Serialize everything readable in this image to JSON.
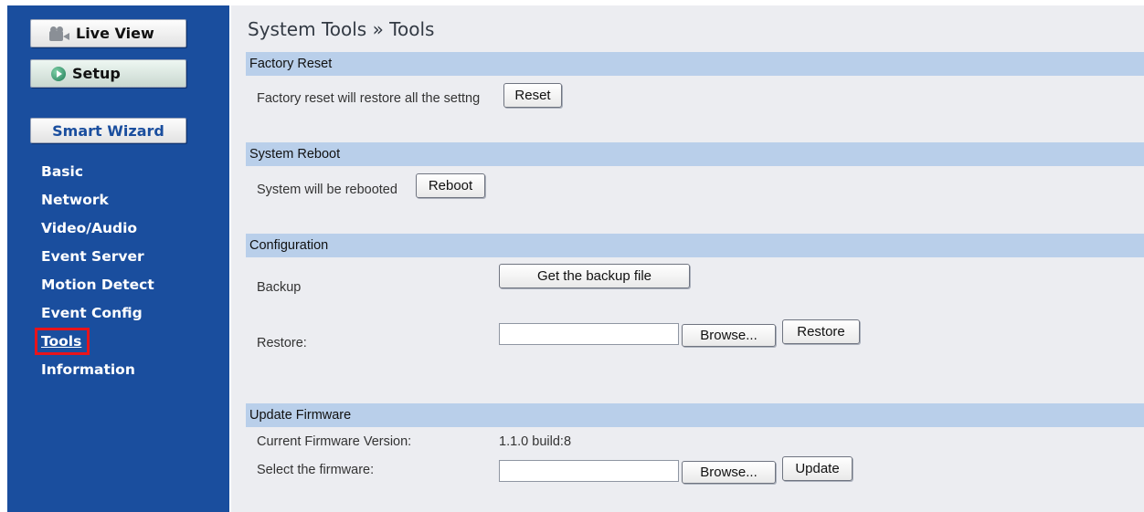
{
  "sidebar": {
    "live_view": "Live View",
    "setup": "Setup",
    "smart_wizard": "Smart Wizard",
    "nav": [
      "Basic",
      "Network",
      "Video/Audio",
      "Event Server",
      "Motion Detect",
      "Event Config",
      "Tools",
      "Information"
    ]
  },
  "page": {
    "title": "System Tools » Tools"
  },
  "factory_reset": {
    "header": "Factory Reset",
    "text": "Factory reset will restore all the settng",
    "button": "Reset"
  },
  "system_reboot": {
    "header": "System Reboot",
    "text": "System will be rebooted",
    "button": "Reboot"
  },
  "configuration": {
    "header": "Configuration",
    "backup_label": "Backup",
    "backup_button": "Get the backup file",
    "restore_label": "Restore:",
    "restore_value": "",
    "browse_button": "Browse...",
    "restore_button": "Restore"
  },
  "firmware": {
    "header": "Update Firmware",
    "version_label": "Current Firmware Version:",
    "version_value": "1.1.0 build:8",
    "select_label": "Select the firmware:",
    "select_value": "",
    "browse_button": "Browse...",
    "update_button": "Update"
  },
  "colors": {
    "sidebar_bg": "#1a4e9e",
    "section_bar": "#b9cfea",
    "content_bg": "#ecedf1",
    "highlight": "#e8141b"
  }
}
